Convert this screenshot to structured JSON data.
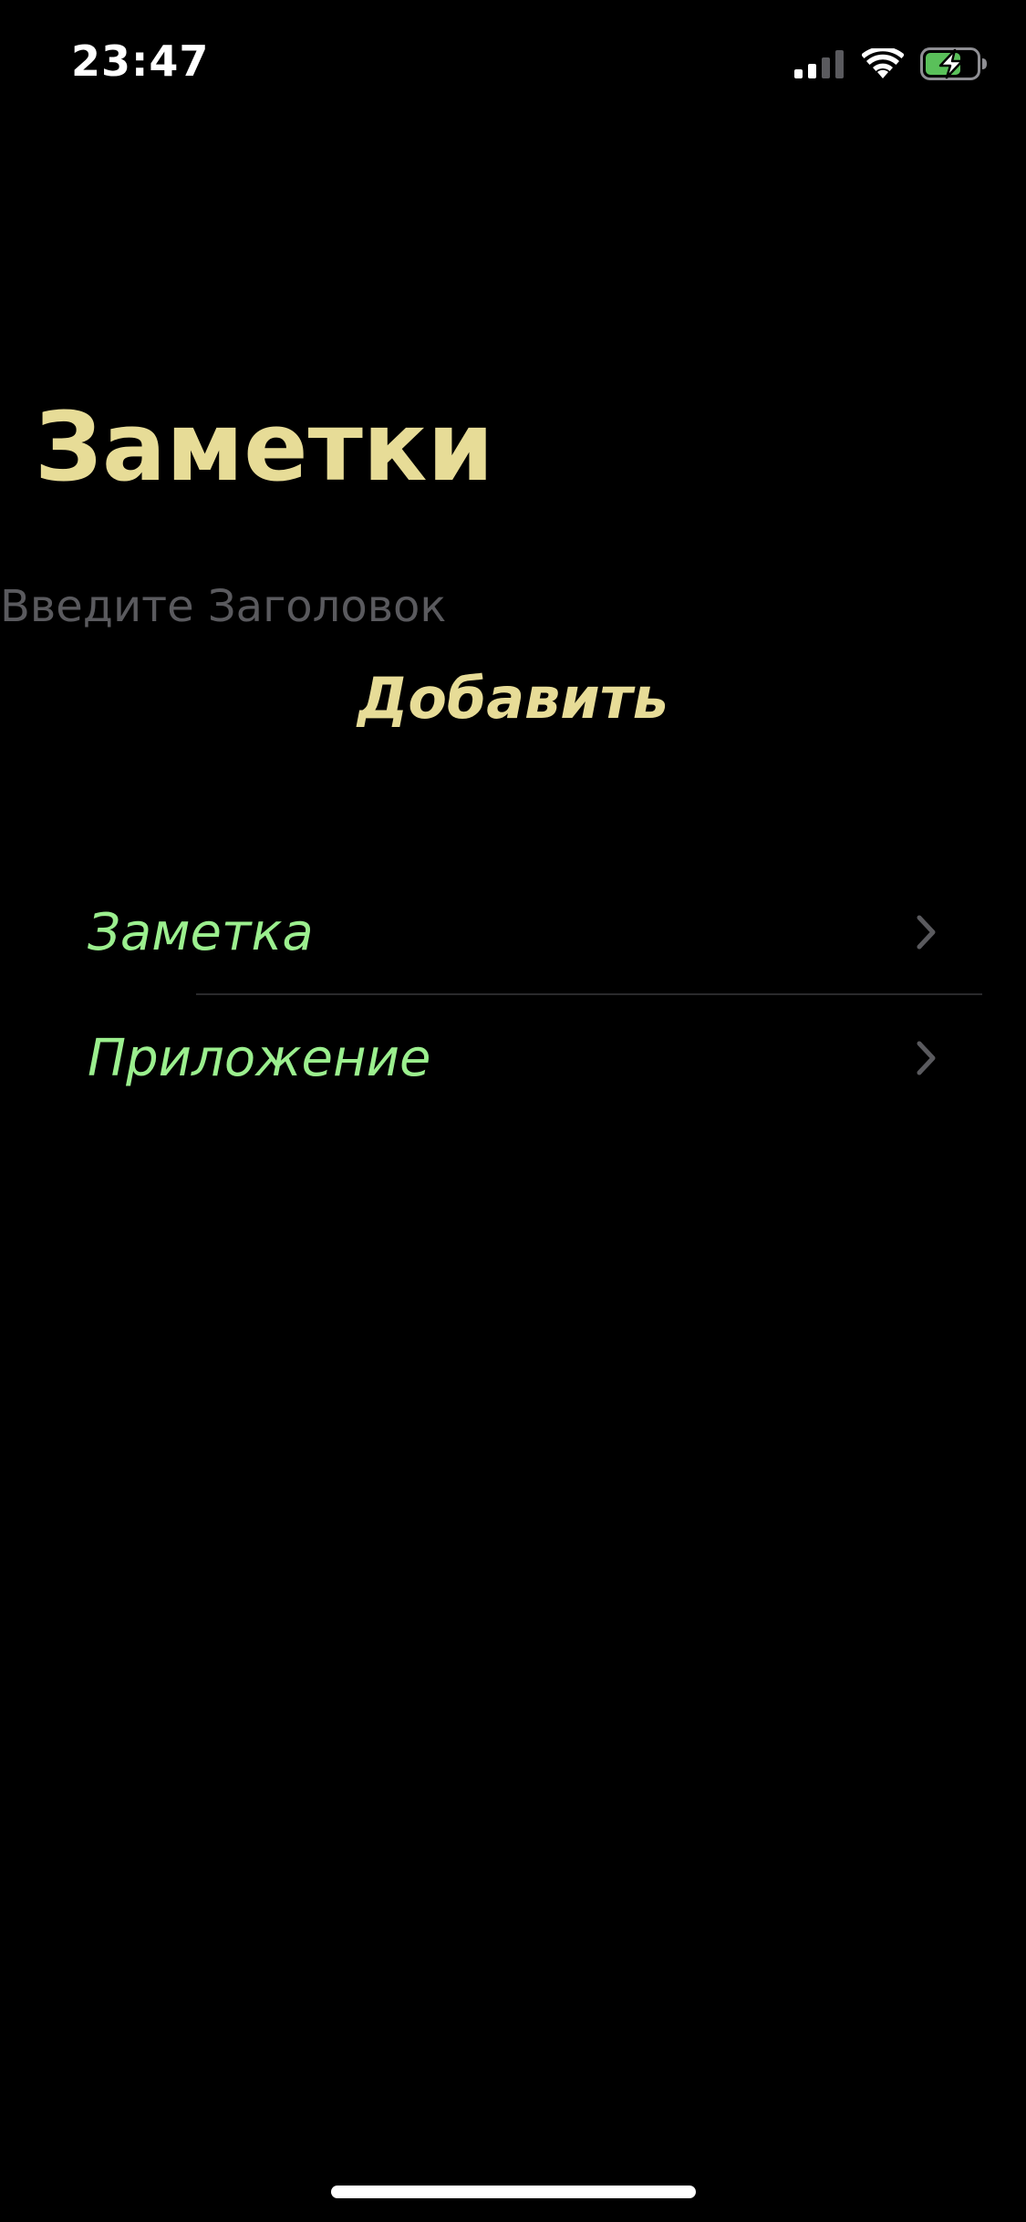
{
  "status_bar": {
    "time": "23:47",
    "icons": [
      "signal-icon",
      "wifi-icon",
      "battery-charging-icon"
    ],
    "battery_color": "#5ac05a"
  },
  "header": {
    "title": "Заметки"
  },
  "form": {
    "input_value": "",
    "input_placeholder": "Введите Заголовок",
    "add_button_label": "Добавить"
  },
  "list": {
    "items": [
      {
        "label": "Заметка",
        "icon": "chevron-right-icon"
      },
      {
        "label": "Приложение",
        "icon": "chevron-right-icon"
      }
    ]
  },
  "colors": {
    "background": "#000000",
    "title": "#e7dc97",
    "list_text": "#9bef8e",
    "placeholder": "#5a5a5e"
  }
}
